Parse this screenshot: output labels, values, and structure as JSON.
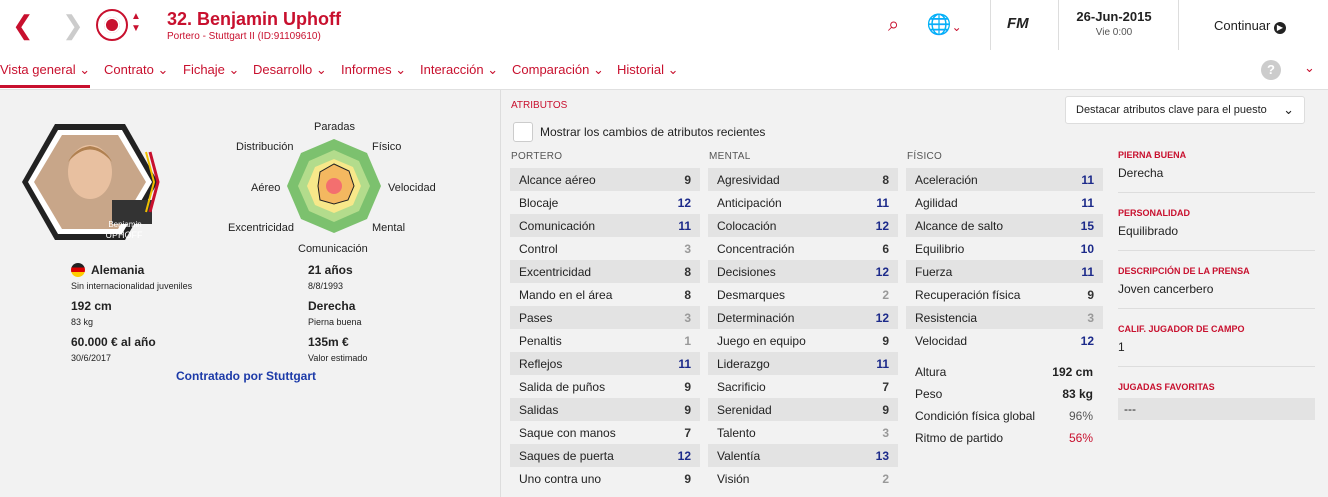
{
  "header": {
    "title": "32. Benjamin Uphoff",
    "subtitle": "Portero - Stuttgart II (ID:91109610)",
    "brand": "FM",
    "date": "26-Jun-2015",
    "time": "Vie 0:00",
    "continue": "Continuar"
  },
  "tabs": [
    "Vista general",
    "Contrato",
    "Fichaje",
    "Desarrollo",
    "Informes",
    "Interacción",
    "Comparación",
    "Historial"
  ],
  "radar": {
    "labels": [
      "Paradas",
      "Físico",
      "Velocidad",
      "Mental",
      "Comunicación",
      "Excentricidad",
      "Aéreo",
      "Distribución"
    ]
  },
  "player": {
    "portrait_name_first": "Benjamin",
    "portrait_name_last": "UPHOFF",
    "nation": "Alemania",
    "intl": "Sin internacionalidad juveniles",
    "height": "192 cm",
    "weight": "83 kg",
    "wage": "60.000 € al año",
    "contract_end": "30/6/2017",
    "age": "21 años",
    "dob": "8/8/1993",
    "foot": "Derecha",
    "foot_lbl": "Pierna buena",
    "value": "135m €",
    "value_lbl": "Valor estimado",
    "contracted": "Contratado por Stuttgart"
  },
  "attrs": {
    "section": "ATRIBUTOS",
    "show_changes": "Mostrar los cambios de atributos recientes",
    "highlight": "Destacar atributos clave para el puesto",
    "gk_head": "PORTERO",
    "mental_head": "MENTAL",
    "phys_head": "FÍSICO",
    "gk": [
      [
        "Alcance aéreo",
        "9"
      ],
      [
        "Blocaje",
        "12"
      ],
      [
        "Comunicación",
        "11"
      ],
      [
        "Control",
        "3"
      ],
      [
        "Excentricidad",
        "8"
      ],
      [
        "Mando en el área",
        "8"
      ],
      [
        "Pases",
        "3"
      ],
      [
        "Penaltis",
        "1"
      ],
      [
        "Reflejos",
        "11"
      ],
      [
        "Salida de puños",
        "9"
      ],
      [
        "Salidas",
        "9"
      ],
      [
        "Saque con manos",
        "7"
      ],
      [
        "Saques de puerta",
        "12"
      ],
      [
        "Uno contra uno",
        "9"
      ]
    ],
    "mental": [
      [
        "Agresividad",
        "8"
      ],
      [
        "Anticipación",
        "11"
      ],
      [
        "Colocación",
        "12"
      ],
      [
        "Concentración",
        "6"
      ],
      [
        "Decisiones",
        "12"
      ],
      [
        "Desmarques",
        "2"
      ],
      [
        "Determinación",
        "12"
      ],
      [
        "Juego en equipo",
        "9"
      ],
      [
        "Liderazgo",
        "11"
      ],
      [
        "Sacrificio",
        "7"
      ],
      [
        "Serenidad",
        "9"
      ],
      [
        "Talento",
        "3"
      ],
      [
        "Valentía",
        "13"
      ],
      [
        "Visión",
        "2"
      ]
    ],
    "phys": [
      [
        "Aceleración",
        "11"
      ],
      [
        "Agilidad",
        "11"
      ],
      [
        "Alcance de salto",
        "15"
      ],
      [
        "Equilibrio",
        "10"
      ],
      [
        "Fuerza",
        "11"
      ],
      [
        "Recuperación física",
        "9"
      ],
      [
        "Resistencia",
        "3"
      ],
      [
        "Velocidad",
        "12"
      ]
    ],
    "phys2": [
      [
        "Altura",
        "192 cm"
      ],
      [
        "Peso",
        "83 kg"
      ],
      [
        "Condición física global",
        "96%"
      ],
      [
        "Ritmo de partido",
        "56%"
      ]
    ]
  },
  "side": [
    [
      "PIERNA BUENA",
      "Derecha"
    ],
    [
      "PERSONALIDAD",
      "Equilibrado"
    ],
    [
      "DESCRIPCIÓN DE LA PRENSA",
      "Joven cancerbero"
    ],
    [
      "CALIF. JUGADOR DE CAMPO",
      "1"
    ],
    [
      "JUGADAS FAVORITAS",
      "---"
    ]
  ]
}
